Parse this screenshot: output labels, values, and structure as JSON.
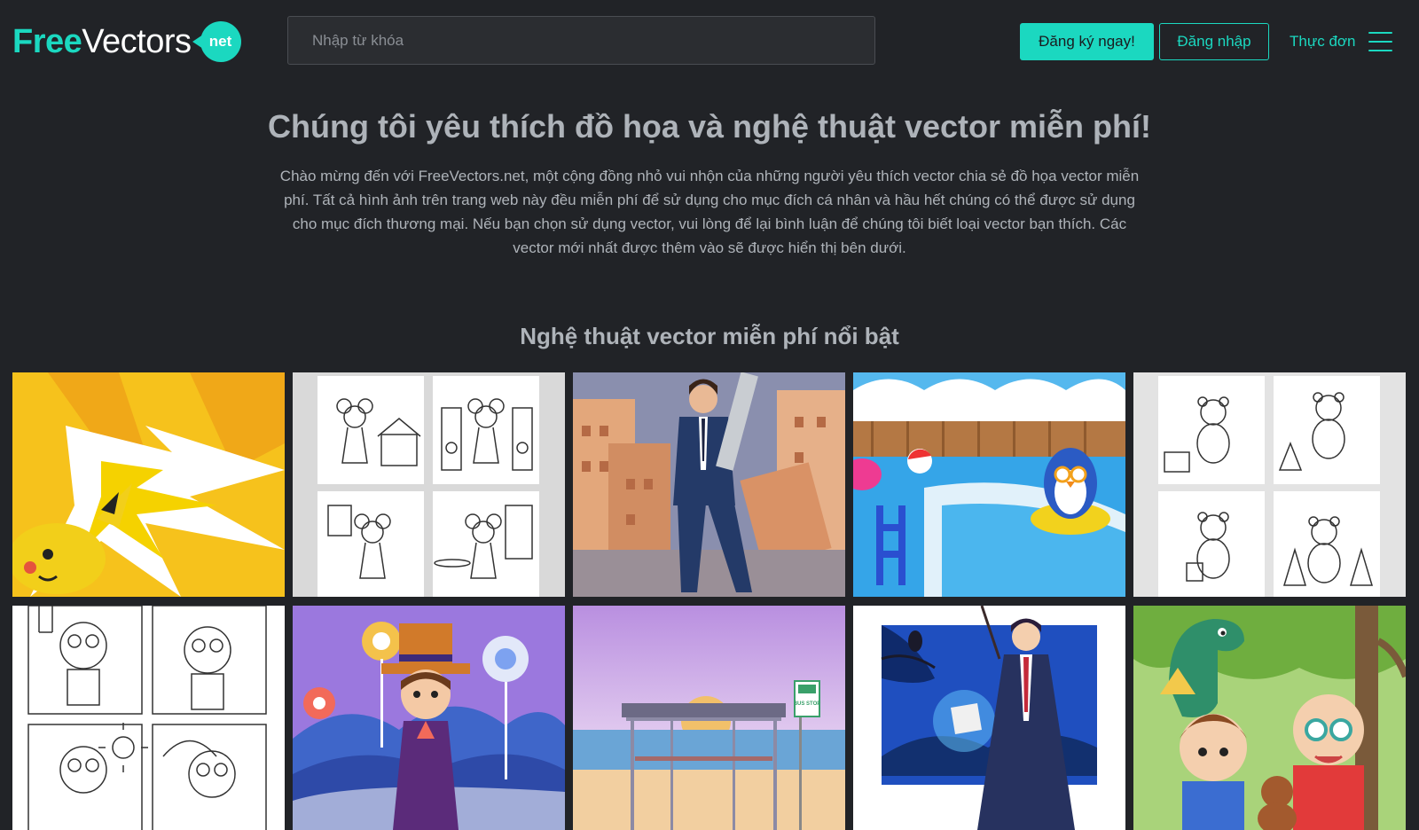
{
  "brand": {
    "logo_free": "Free",
    "logo_vectors": "Vectors",
    "logo_net": "net",
    "accent_color": "#1bd8c0",
    "background_color": "#212327"
  },
  "header": {
    "search_placeholder": "Nhập từ khóa",
    "register_label": "Đăng ký ngay!",
    "login_label": "Đăng nhập",
    "menu_label": "Thực đơn",
    "menu_icon": "hamburger-icon"
  },
  "hero": {
    "title": "Chúng tôi yêu thích đồ họa và nghệ thuật vector miễn phí!",
    "text": "Chào mừng đến với FreeVectors.net, một cộng đồng nhỏ vui nhộn của những người yêu thích vector chia sẻ đồ họa vector miễn phí. Tất cả hình ảnh trên trang web này đều miễn phí để sử dụng cho mục đích cá nhân và hầu hết chúng có thể được sử dụng cho mục đích thương mại. Nếu bạn chọn sử dụng vector, vui lòng để lại bình luận để chúng tôi biết loại vector bạn thích. Các vector mới nhất được thêm vào sẽ được hiển thị bên dưới."
  },
  "featured": {
    "title": "Nghệ thuật vector miễn phí nổi bật",
    "items": [
      {
        "subject": "yellow-electric-creature-illustration"
      },
      {
        "subject": "mouse-girl-coloring-pages"
      },
      {
        "subject": "man-in-suit-with-gun-ruined-city"
      },
      {
        "subject": "penguin-in-swimming-pool"
      },
      {
        "subject": "bear-coloring-pages"
      },
      {
        "subject": "cat-robot-coloring-pages"
      },
      {
        "subject": "candy-land-chocolatier"
      },
      {
        "subject": "beach-bus-stop-sunset"
      },
      {
        "subject": "wizard-with-book-and-owl"
      },
      {
        "subject": "kids-with-dinosaur-in-forest"
      }
    ],
    "bus_stop_sign": "BUS STOP"
  }
}
